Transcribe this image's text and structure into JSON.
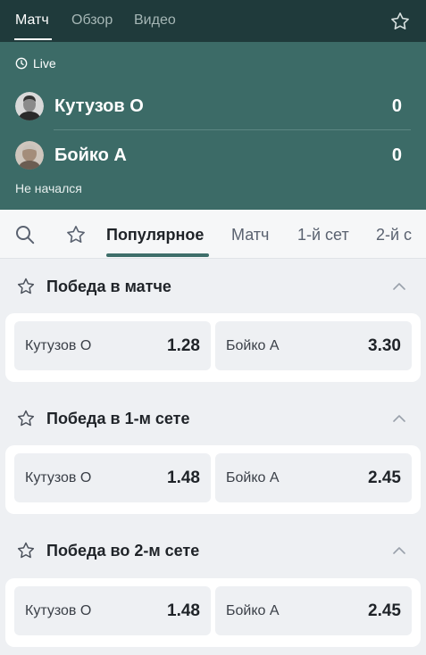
{
  "nav": {
    "tabs": [
      {
        "label": "Матч"
      },
      {
        "label": "Обзор"
      },
      {
        "label": "Видео"
      }
    ],
    "favorite_icon": "star-outline-icon"
  },
  "scoreboard": {
    "live_label": "Live",
    "live_icon": "clock-icon",
    "players": [
      {
        "name": "Кутузов О",
        "score": "0"
      },
      {
        "name": "Бойко А",
        "score": "0"
      }
    ],
    "status": "Не начался"
  },
  "filters": {
    "search_icon": "search-icon",
    "favorites_icon": "star-outline-icon",
    "tabs": [
      {
        "label": "Популярное"
      },
      {
        "label": "Матч"
      },
      {
        "label": "1-й сет"
      },
      {
        "label": "2-й с"
      }
    ]
  },
  "markets": [
    {
      "title": "Победа в матче",
      "odds": [
        {
          "name": "Кутузов О",
          "value": "1.28"
        },
        {
          "name": "Бойко А",
          "value": "3.30"
        }
      ]
    },
    {
      "title": "Победа в 1-м сете",
      "odds": [
        {
          "name": "Кутузов О",
          "value": "1.48"
        },
        {
          "name": "Бойко А",
          "value": "2.45"
        }
      ]
    },
    {
      "title": "Победа во 2-м сете",
      "odds": [
        {
          "name": "Кутузов О",
          "value": "1.48"
        },
        {
          "name": "Бойко А",
          "value": "2.45"
        }
      ]
    }
  ],
  "colors": {
    "header_bg": "#1f3a3b",
    "scoreboard_bg": "#3c6b67",
    "accent": "#3e6e6a",
    "page_bg": "#eef0f3"
  }
}
